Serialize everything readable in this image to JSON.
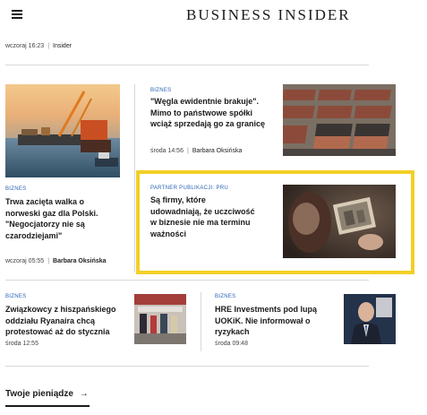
{
  "header": {
    "brand": "BUSINESS INSIDER",
    "menu_icon": "hamburger-icon"
  },
  "top_article": {
    "time": "wczoraj 16:23",
    "author": "Insider"
  },
  "articles": [
    {
      "time": "wczoraj 05:55",
      "author": "Barbara Oksińska",
      "tag": "BIZNES",
      "title_lines": [
        "Trwa zacięta walka o",
        "norweski gaz dla Polski.",
        "\"Negocjatorzy nie są",
        "czarodziejami\""
      ],
      "image": "offshore-construction-photo"
    },
    {
      "time": "środa 14:56",
      "author": "Barbara Oksińska",
      "tag": "BIZNES",
      "title_lines": [
        "\"Węgla ewidentnie brakuje\".",
        "Mimo to państwowe spółki",
        "wciąż sprzedają go za granicę"
      ],
      "image": "coal-train-photo"
    },
    {
      "tag": "PARTNER PUBLIKACJI: PRU",
      "title_lines": [
        "Są firmy, które",
        "udowadniają, że uczciwość",
        "w biznesie nie ma terminu",
        "ważności"
      ],
      "image": "vintage-photo-in-hand"
    },
    {
      "time": "środa 12:55",
      "tag": "BIZNES",
      "title_lines": [
        "Związkowcy z hiszpańskiego",
        "oddziału Ryanaira chcą",
        "protestować aż do stycznia"
      ],
      "image": "airport-queue-photo"
    },
    {
      "time": "środa 09:48",
      "tag": "BIZNES",
      "title_lines": [
        "HRE Investments pod lupą",
        "UOKiK. Nie informował o",
        "ryzykach"
      ],
      "image": "uokik-official-portrait"
    }
  ],
  "section": {
    "title": "Twoje pieniądze",
    "arrow": "→"
  },
  "colors": {
    "accent_tag": "#2a63b5",
    "partner_border": "#f2cf27"
  }
}
